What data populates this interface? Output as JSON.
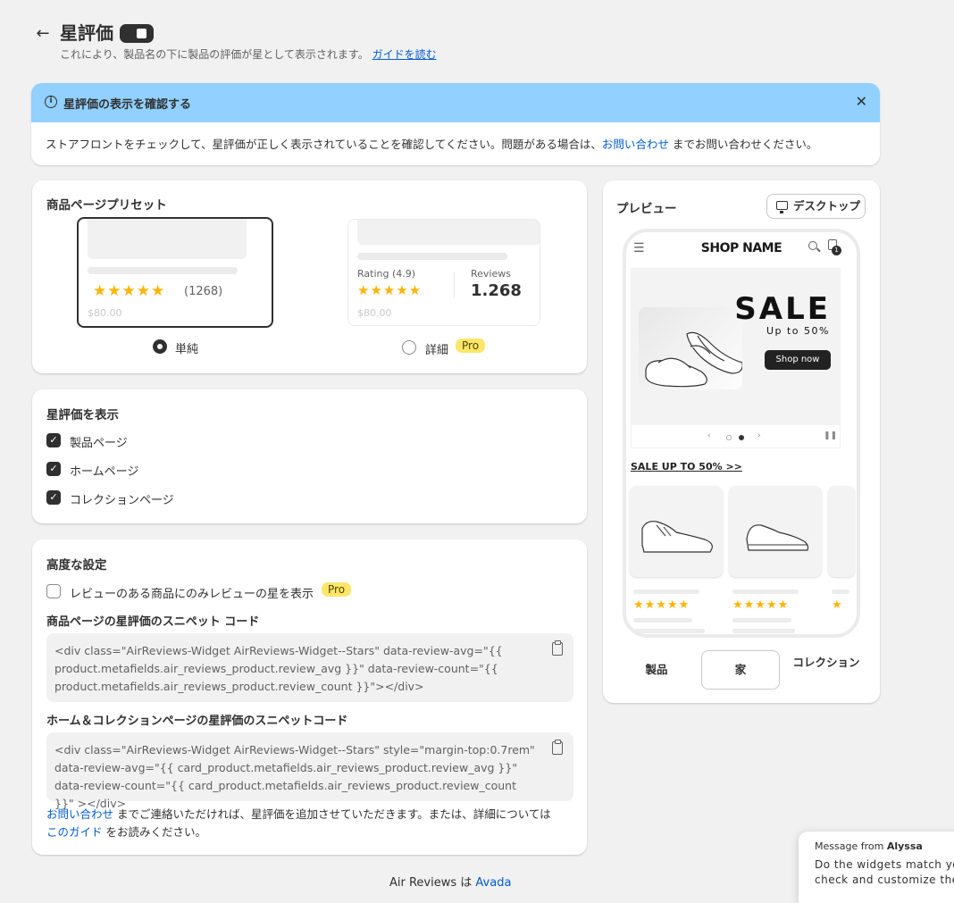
{
  "header": {
    "back_icon": "arrow-left-icon",
    "title": "星評価",
    "toggle_on": true,
    "subtitle": "これにより、製品名の下に製品の評価が星として表示されます。",
    "guide_link": "ガイドを読む"
  },
  "banner": {
    "title": "星評価の表示を確認する",
    "body_before": "ストアフロントをチェックして、星評価が正しく表示されていることを確認してください。問題がある場合は、",
    "contact_link": "お問い合わせ",
    "body_after": " までお問い合わせください。",
    "accent": "#91d0ff"
  },
  "presets": {
    "title": "商品ページプリセット",
    "simple": {
      "stars": "★★★★★",
      "count": "(1268)",
      "price": "$80.00",
      "label": "単純",
      "selected": true
    },
    "detailed": {
      "rating_label": "Rating (4.9)",
      "stars": "★★★★★",
      "reviews_label": "Reviews",
      "reviews_value": "1.268",
      "price": "$80.00",
      "label": "詳細",
      "badge": "Pro",
      "selected": false
    }
  },
  "display": {
    "title": "星評価を表示",
    "options": [
      {
        "label": "製品ページ",
        "checked": true
      },
      {
        "label": "ホームページ",
        "checked": true
      },
      {
        "label": "コレクションページ",
        "checked": true
      }
    ]
  },
  "advanced": {
    "title": "高度な設定",
    "only_reviewed_label": "レビューのある商品にのみレビューの星を表示",
    "only_reviewed_checked": false,
    "badge": "Pro",
    "product_snippet_title": "商品ページの星評価のスニペット コード",
    "product_snippet": "<div class=\"AirReviews-Widget AirReviews-Widget--Stars\" data-review-avg=\"{{ product.metafields.air_reviews_product.review_avg }}\" data-review-count=\"{{ product.metafields.air_reviews_product.review_count }}\"></div>",
    "collection_snippet_title": "ホーム＆コレクションページの星評価のスニペットコード",
    "collection_snippet": "<div class=\"AirReviews-Widget AirReviews-Widget--Stars\" style=\"margin-top:0.7rem\" data-review-avg=\"{{ card_product.metafields.air_reviews_product.review_avg }}\" data-review-count=\"{{ card_product.metafields.air_reviews_product.review_count }}\" ></div>",
    "footer_link1": "お問い合わせ",
    "footer_mid": " までご連絡いただければ、星評価を追加させていただきます。または、詳細については",
    "footer_link2": "このガイド",
    "footer_end": " をお読みください。"
  },
  "preview": {
    "title": "プレビュー",
    "device_button": "デスクトップ",
    "shop_name": "SHOP NAME",
    "cart_count": "1",
    "sale_title": "SALE",
    "sale_sub": "Up to 50%",
    "shop_now": "Shop now",
    "sale_link": "SALE UP TO 50% >>",
    "mini_stars": "★★★★★",
    "tabs": [
      {
        "label": "製品",
        "active": false
      },
      {
        "label": "家",
        "active": true
      },
      {
        "label": "コレクション",
        "active": false
      }
    ]
  },
  "footer": {
    "text": "Air Reviews は",
    "link": "Avada"
  },
  "chat": {
    "from_prefix": "Message from",
    "from_name": "Alyssa",
    "message_line1": "Do the widgets match you",
    "message_line2": "check and customize them"
  }
}
